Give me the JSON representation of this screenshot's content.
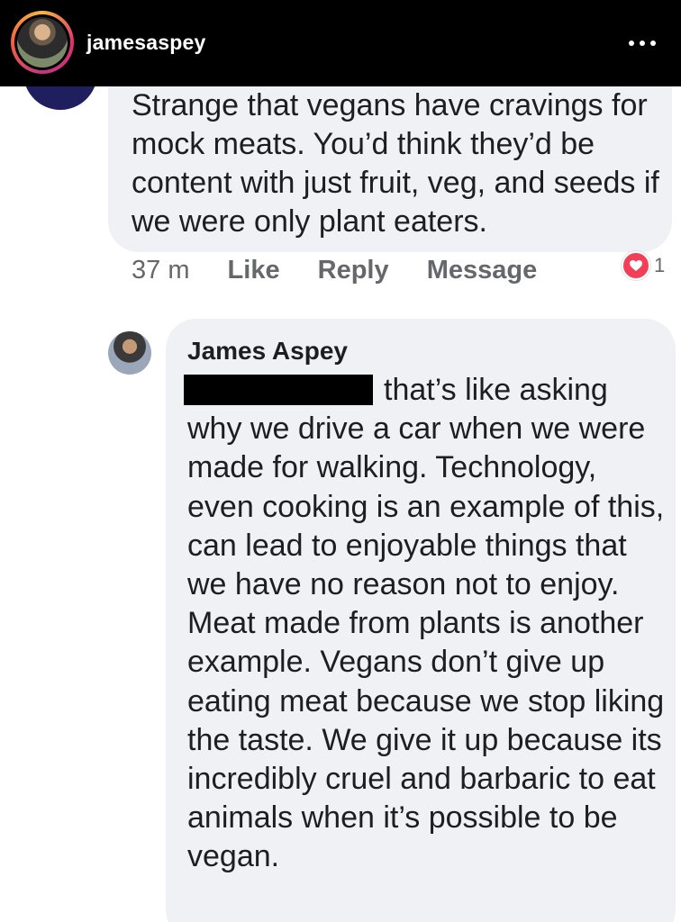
{
  "header": {
    "username": "jamesaspey",
    "avatar_icon": "profile-photo",
    "more_icon": "ellipsis-icon"
  },
  "comment": {
    "text": "Strange that vegans have cravings for mock meats. You’d think they’d be content with just fruit, veg, and seeds if we were only plant eaters.",
    "time": "37 m",
    "like_label": "Like",
    "reply_label": "Reply",
    "message_label": "Message",
    "reaction_icon": "heart-icon",
    "reaction_count": "1",
    "colors": {
      "bubble": "#f0f1f4",
      "reaction": "#f33e58"
    }
  },
  "reply": {
    "author": "James Aspey",
    "text": "that’s like asking why we drive a car when we were made for walking. Technology, even cooking is an example of this, can lead to enjoyable things that we have no reason not to enjoy. Meat made from plants is another example. Vegans don’t give up eating meat because we stop liking the taste. We give it up because its incredibly cruel and barbaric to eat animals when it’s possible to be vegan."
  }
}
